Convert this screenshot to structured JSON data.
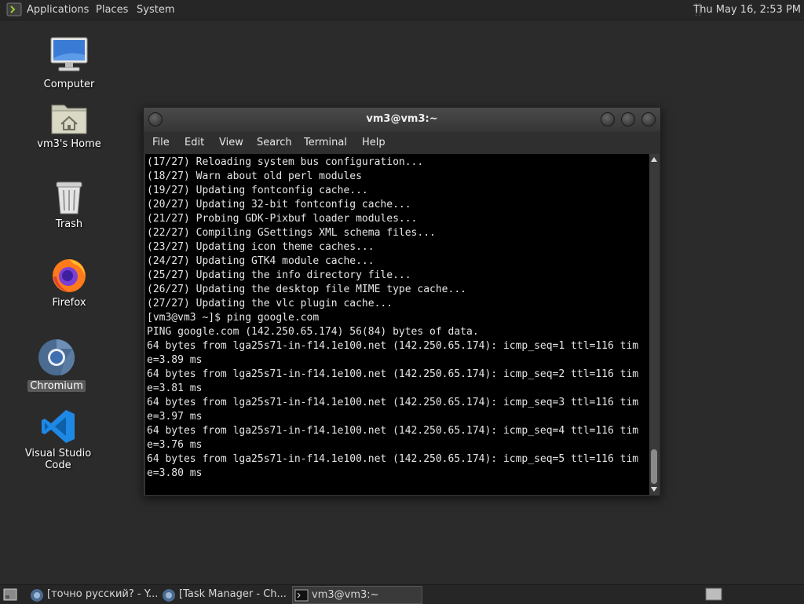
{
  "top_panel": {
    "menus": [
      "Applications",
      "Places",
      "System"
    ],
    "clock": "Thu May 16,  2:53 PM"
  },
  "desktop_icons": [
    {
      "label": "Computer",
      "icon": "computer-icon"
    },
    {
      "label": "vm3's Home",
      "icon": "home-folder-icon"
    },
    {
      "label": "Trash",
      "icon": "trash-icon"
    },
    {
      "label": "Firefox",
      "icon": "firefox-icon"
    },
    {
      "label": "Chromium",
      "icon": "chromium-icon",
      "selected": true
    },
    {
      "label": "Visual Studio Code",
      "icon": "vscode-icon"
    }
  ],
  "terminal": {
    "title": "vm3@vm3:~",
    "menu": [
      "File",
      "Edit",
      "View",
      "Search",
      "Terminal",
      "Help"
    ],
    "lines": [
      "(17/27) Reloading system bus configuration...",
      "(18/27) Warn about old perl modules",
      "(19/27) Updating fontconfig cache...",
      "(20/27) Updating 32-bit fontconfig cache...",
      "(21/27) Probing GDK-Pixbuf loader modules...",
      "(22/27) Compiling GSettings XML schema files...",
      "(23/27) Updating icon theme caches...",
      "(24/27) Updating GTK4 module cache...",
      "(25/27) Updating the info directory file...",
      "(26/27) Updating the desktop file MIME type cache...",
      "(27/27) Updating the vlc plugin cache...",
      "[vm3@vm3 ~]$ ping google.com",
      "PING google.com (142.250.65.174) 56(84) bytes of data.",
      "64 bytes from lga25s71-in-f14.1e100.net (142.250.65.174): icmp_seq=1 ttl=116 tim",
      "e=3.89 ms",
      "64 bytes from lga25s71-in-f14.1e100.net (142.250.65.174): icmp_seq=2 ttl=116 tim",
      "e=3.81 ms",
      "64 bytes from lga25s71-in-f14.1e100.net (142.250.65.174): icmp_seq=3 ttl=116 tim",
      "e=3.97 ms",
      "64 bytes from lga25s71-in-f14.1e100.net (142.250.65.174): icmp_seq=4 ttl=116 tim",
      "e=3.76 ms",
      "64 bytes from lga25s71-in-f14.1e100.net (142.250.65.174): icmp_seq=5 ttl=116 tim",
      "e=3.80 ms"
    ]
  },
  "taskbar": {
    "tasks": [
      {
        "label": "[точно русский? - Y...",
        "icon": "browser-icon"
      },
      {
        "label": "[Task Manager - Ch...",
        "icon": "browser-icon"
      },
      {
        "label": "vm3@vm3:~",
        "icon": "terminal-icon",
        "active": true
      }
    ]
  },
  "colors": {
    "desktop_bg": "#2b2b2b",
    "panel_bg": "#262626",
    "terminal_bg": "#000000",
    "terminal_fg": "#e6e6e6"
  }
}
